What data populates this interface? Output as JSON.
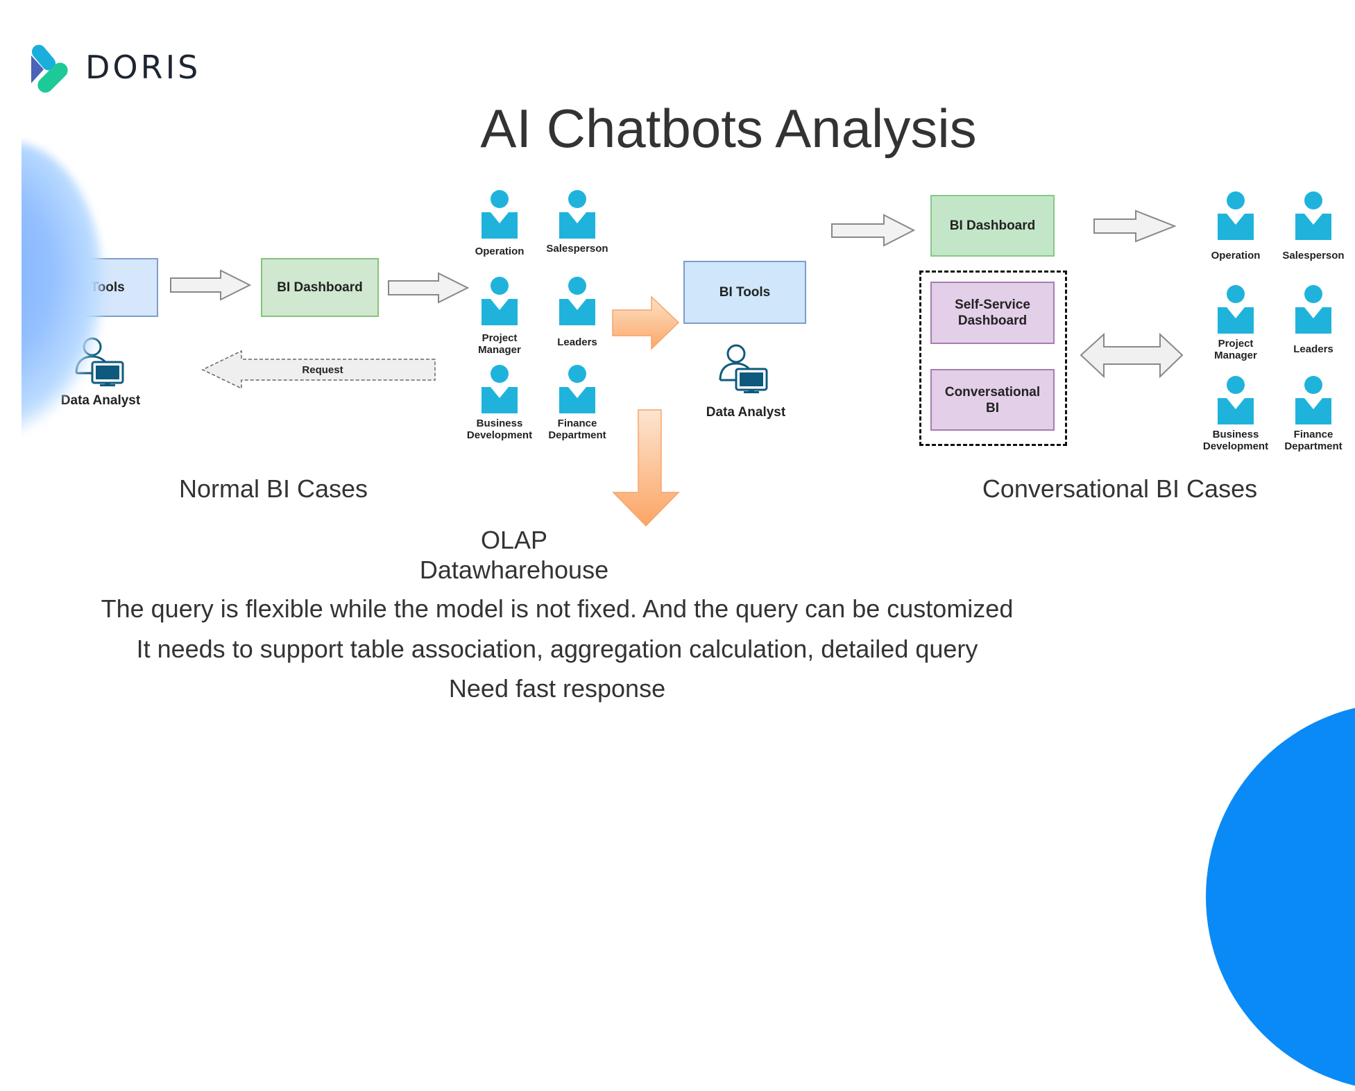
{
  "logo": {
    "text": "DORIS",
    "colors": {
      "blue": "#4b63b8",
      "cyan": "#1aaedc",
      "green": "#1dc997"
    }
  },
  "title": "AI Chatbots Analysis",
  "normal_bi": {
    "bi_tools": "BI Tools",
    "bi_dashboard": "BI Dashboard",
    "data_analyst": "Data Analyst",
    "request_label": "Request",
    "section_label": "Normal BI Cases",
    "roles": [
      "Operation",
      "Salesperson",
      "Project\nManager",
      "Leaders",
      "Business\nDevelopment",
      "Finance\nDepartment"
    ]
  },
  "middle": {
    "bi_tools": "BI Tools",
    "data_analyst": "Data Analyst",
    "olap_line1": "OLAP",
    "olap_line2": "Datawharehouse"
  },
  "conversational_bi": {
    "bi_dashboard": "BI Dashboard",
    "self_service": "Self-Service\nDashboard",
    "conversational": "Conversational\nBI",
    "section_label": "Conversational BI Cases",
    "roles": [
      "Operation",
      "Salesperson",
      "Project\nManager",
      "Leaders",
      "Business\nDevelopment",
      "Finance\nDepartment"
    ]
  },
  "body_lines": [
    "The query is flexible while the model is not fixed. And the query can be customized",
    "It needs to support table association, aggregation calculation, detailed query",
    "Need fast response"
  ],
  "colors": {
    "person": "#1fb3dc",
    "analyst": "#0e5a7c",
    "orange_arrow": "#fbb37a",
    "corner_circle": "#0a8af7"
  }
}
